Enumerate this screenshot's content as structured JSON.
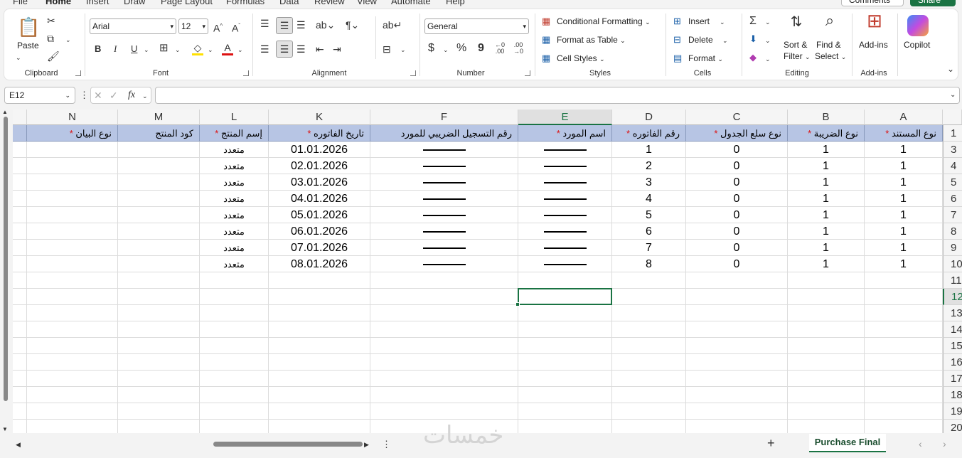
{
  "menu": {
    "tabs": [
      "File",
      "Home",
      "Insert",
      "Draw",
      "Page Layout",
      "Formulas",
      "Data",
      "Review",
      "View",
      "Automate",
      "Help"
    ],
    "comments": "Comments",
    "share": "Share"
  },
  "ribbon": {
    "clipboard": {
      "paste": "Paste",
      "label": "Clipboard"
    },
    "font": {
      "name": "Arial",
      "size": "12",
      "bold": "B",
      "italic": "I",
      "underline": "U",
      "label": "Font"
    },
    "alignment": {
      "label": "Alignment"
    },
    "number": {
      "format": "General",
      "currency": "$",
      "percent": "%",
      "comma": "9",
      "label": "Number"
    },
    "styles": {
      "conditional": "Conditional Formatting",
      "table": "Format as Table",
      "cellstyles": "Cell Styles",
      "label": "Styles"
    },
    "cells": {
      "insert": "Insert",
      "delete": "Delete",
      "format": "Format",
      "label": "Cells"
    },
    "editing": {
      "sort": "Sort &",
      "sort2": "Filter",
      "find": "Find &",
      "find2": "Select",
      "label": "Editing"
    },
    "addins": {
      "addins": "Add-ins",
      "label": "Add-ins"
    },
    "copilot": {
      "label": "Copilot"
    }
  },
  "formula_bar": {
    "name_box": "E12",
    "fx": "fx",
    "formula": ""
  },
  "columns": [
    "N",
    "M",
    "L",
    "K",
    "F",
    "E",
    "D",
    "C",
    "B",
    "A"
  ],
  "header_row": [
    "نوع البيان",
    "كود المنتج",
    "إسم المنتج",
    "تاريخ الفاتوره",
    "رقم التسجيل الضريبي للمورد",
    "اسم المورد",
    "رقم الفاتوره",
    "نوع سلع الجدول",
    "نوع الضريبة",
    "نوع المستند"
  ],
  "header_required": [
    true,
    false,
    true,
    true,
    false,
    true,
    true,
    true,
    true,
    true
  ],
  "rows": [
    [
      "",
      "",
      "متعدد",
      "01.01.2026",
      "dash",
      "dash",
      "1",
      "0",
      "1",
      "1"
    ],
    [
      "",
      "",
      "متعدد",
      "02.01.2026",
      "dash",
      "dash",
      "2",
      "0",
      "1",
      "1"
    ],
    [
      "",
      "",
      "متعدد",
      "03.01.2026",
      "dash",
      "dash",
      "3",
      "0",
      "1",
      "1"
    ],
    [
      "",
      "",
      "متعدد",
      "04.01.2026",
      "dash",
      "dash",
      "4",
      "0",
      "1",
      "1"
    ],
    [
      "",
      "",
      "متعدد",
      "05.01.2026",
      "dash",
      "dash",
      "5",
      "0",
      "1",
      "1"
    ],
    [
      "",
      "",
      "متعدد",
      "06.01.2026",
      "dash",
      "dash",
      "6",
      "0",
      "1",
      "1"
    ],
    [
      "",
      "",
      "متعدد",
      "07.01.2026",
      "dash",
      "dash",
      "7",
      "0",
      "1",
      "1"
    ],
    [
      "",
      "",
      "متعدد",
      "08.01.2026",
      "dash",
      "dash",
      "8",
      "0",
      "1",
      "1"
    ]
  ],
  "row_numbers": [
    "1",
    "3",
    "4",
    "5",
    "6",
    "7",
    "8",
    "9",
    "10",
    "11",
    "12",
    "13",
    "14",
    "15",
    "16",
    "17",
    "18",
    "19",
    "20"
  ],
  "selected_cell": "E12",
  "sheet_tab": "Purchase Final",
  "watermark": "خمسات",
  "colors": {
    "accent": "#1a7343",
    "header_fill": "#b7c5e4",
    "required": "#dd1111"
  }
}
